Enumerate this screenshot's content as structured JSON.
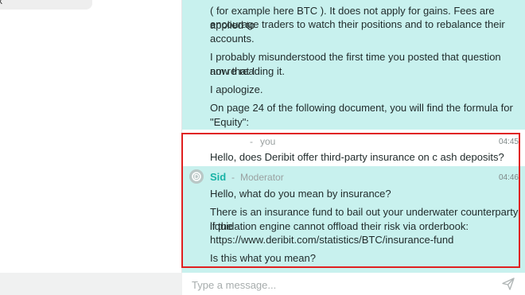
{
  "left_panel": {
    "card_text": "x"
  },
  "chat": {
    "earlier_message": {
      "lines": [
        "( for example here BTC ). It does not apply for gains. Fees are applied to",
        "encourage traders to watch their positions and to rebalance their",
        "accounts.",
        "I probably misunderstood the first time you posted that question now that I",
        "am re reading it.",
        "I apologize.",
        "On page 24 of the following document, you will find the formula for",
        "\"Equity\": https://statics.deribit.com/files/DeribitInstitutionalSetupGuide.pdf"
      ]
    },
    "user_message": {
      "separator": "-",
      "author": "you",
      "time": "04:45",
      "text": "Hello, does Deribit offer third-party insurance on c ash deposits?"
    },
    "moderator_message": {
      "author": "Sid",
      "separator": "-",
      "role": "Moderator",
      "time": "04:46",
      "lines": [
        "Hello, what do you mean by insurance?",
        "There is an insurance fund to bail out your underwater counterparty if the",
        "liquidation engine cannot offload their risk via orderbook:",
        "https://www.deribit.com/statistics/BTC/insurance-fund",
        "Is this what you mean?"
      ]
    }
  },
  "composer": {
    "placeholder": "Type a message..."
  },
  "colors": {
    "bubble": "#c8f1ee",
    "accent": "#19b3a6",
    "highlight_border": "#e02020"
  },
  "icons": {
    "avatar": "deribit-logo-icon",
    "send": "send-icon"
  }
}
